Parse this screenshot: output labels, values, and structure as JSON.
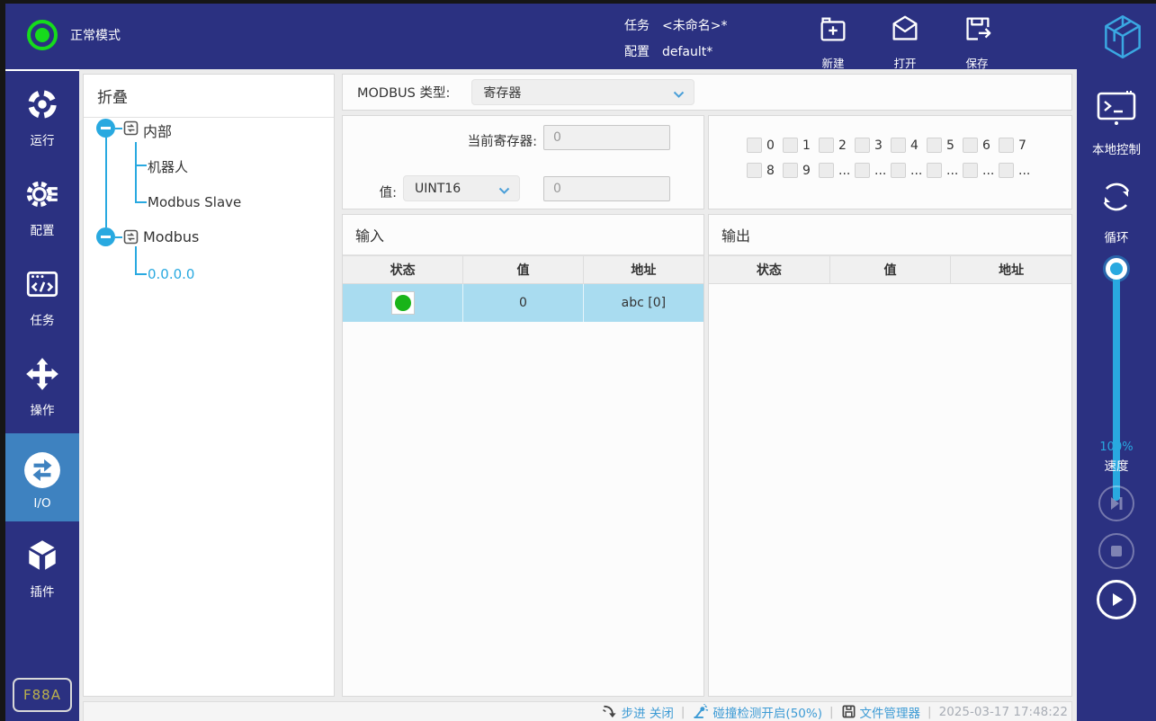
{
  "header": {
    "mode_text": "正常模式",
    "task_label": "任务",
    "task_value": "<未命名>*",
    "config_label": "配置",
    "config_value": "default*",
    "new_label": "新建",
    "open_label": "打开",
    "save_label": "保存"
  },
  "sidebar": {
    "items": [
      {
        "label": "运行",
        "icon": "run-target-icon"
      },
      {
        "label": "配置",
        "icon": "gear-icon"
      },
      {
        "label": "任务",
        "icon": "code-window-icon"
      },
      {
        "label": "操作",
        "icon": "move-arrows-icon"
      },
      {
        "label": "I/O",
        "icon": "io-swap-icon",
        "active": true
      },
      {
        "label": "插件",
        "icon": "cube-icon"
      }
    ],
    "badge": "F88A"
  },
  "tree": {
    "title": "折叠",
    "nodes": [
      {
        "label": "内部"
      },
      {
        "label": "机器人"
      },
      {
        "label": "Modbus Slave"
      },
      {
        "label": "Modbus"
      },
      {
        "label": "0.0.0.0",
        "selected": true
      }
    ]
  },
  "modbus": {
    "type_label": "MODBUS 类型:",
    "type_value": "寄存器",
    "current_register_label": "当前寄存器:",
    "current_register_value": "0",
    "value_label": "值:",
    "value_type": "UINT16",
    "value": "0"
  },
  "registers": {
    "row1": [
      "0",
      "1",
      "2",
      "3",
      "4",
      "5",
      "6",
      "7"
    ],
    "row2": [
      "8",
      "9",
      "...",
      "...",
      "...",
      "...",
      "...",
      "..."
    ]
  },
  "input_table": {
    "title": "输入",
    "headers": [
      "状态",
      "值",
      "地址"
    ],
    "rows": [
      {
        "status": "on",
        "value": "0",
        "address": "abc [0]"
      }
    ]
  },
  "output_table": {
    "title": "输出",
    "headers": [
      "状态",
      "值",
      "地址"
    ],
    "rows": []
  },
  "right_panel": {
    "local_control": "本地控制",
    "loop": "循环",
    "speed_value": "100%",
    "speed_label": "速度"
  },
  "status_bar": {
    "step": "步进 关闭",
    "collision": "碰撞检测开启(50%)",
    "file_manager": "文件管理器",
    "timestamp": "2025-03-17 17:48:22"
  },
  "colors": {
    "navy": "#2B3181",
    "accent_blue": "#29A9E0",
    "active_item": "#3E82C0",
    "selected_row": "#A9DCF0",
    "status_green": "#19B419",
    "link_blue": "#3D9BD5",
    "badge_yellow": "#BBB14C"
  }
}
